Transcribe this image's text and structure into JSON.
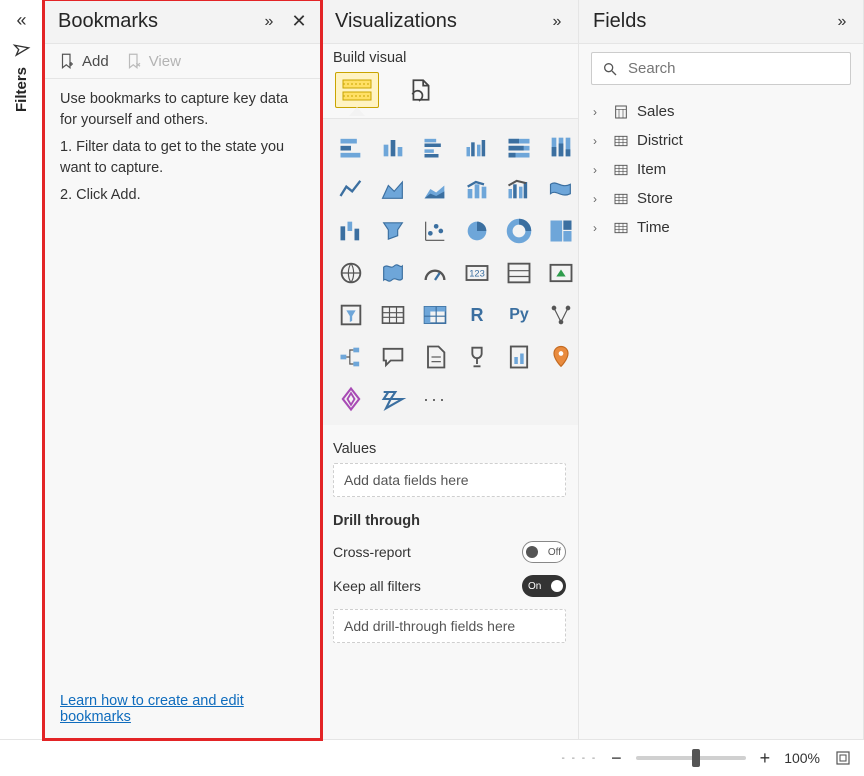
{
  "filters": {
    "label": "Filters"
  },
  "bookmarks": {
    "title": "Bookmarks",
    "add_label": "Add",
    "view_label": "View",
    "intro": "Use bookmarks to capture key data for yourself and others.",
    "step1": "1. Filter data to get to the state you want to capture.",
    "step2": "2. Click Add.",
    "learn_link": "Learn how to create and edit bookmarks"
  },
  "viz": {
    "title": "Visualizations",
    "subtitle": "Build visual",
    "values_label": "Values",
    "values_placeholder": "Add data fields here",
    "drill_label": "Drill through",
    "cross_report_label": "Cross-report",
    "cross_report_state": "Off",
    "keep_filters_label": "Keep all filters",
    "keep_filters_state": "On",
    "drill_placeholder": "Add drill-through fields here",
    "more": "···",
    "r_label": "R",
    "py_label": "Py"
  },
  "fields": {
    "title": "Fields",
    "search_placeholder": "Search",
    "items": [
      "Sales",
      "District",
      "Item",
      "Store",
      "Time"
    ]
  },
  "footer": {
    "minus": "−",
    "plus": "+",
    "zoom": "100%"
  }
}
